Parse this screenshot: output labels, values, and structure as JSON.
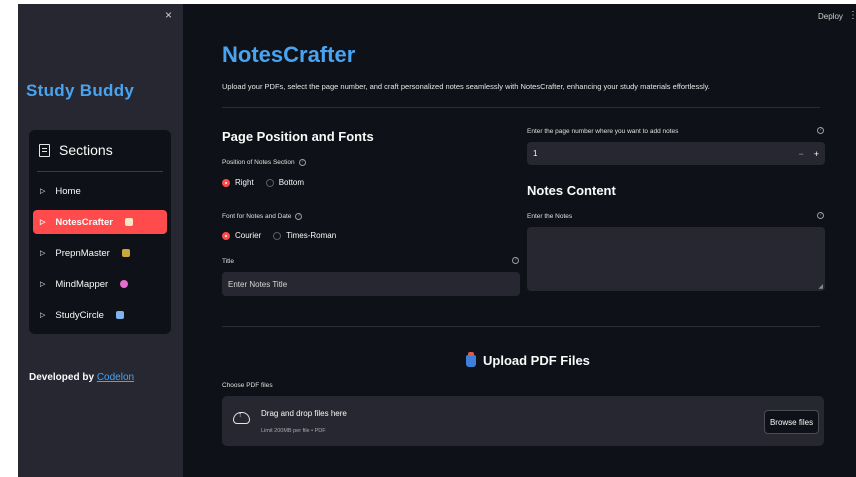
{
  "sidebar": {
    "close_glyph": "×",
    "title": "Study Buddy",
    "sections_label": "Sections",
    "items": [
      {
        "label": "Home",
        "active": false
      },
      {
        "label": "NotesCrafter",
        "active": true
      },
      {
        "label": "PrepnMaster",
        "active": false
      },
      {
        "label": "MindMapper",
        "active": false
      },
      {
        "label": "StudyCircle",
        "active": false
      }
    ],
    "developed_by": "Developed by",
    "developer_link": "Codelon"
  },
  "header": {
    "deploy_label": "Deploy",
    "menu_glyph": "⋮"
  },
  "main": {
    "title": "NotesCrafter",
    "description": "Upload your PDFs, select the page number, and craft personalized notes seamlessly with NotesCrafter, enhancing your study materials effortlessly.",
    "page_position_heading": "Page Position and Fonts",
    "position_label": "Position of Notes Section",
    "position_options": [
      "Right",
      "Bottom"
    ],
    "position_selected": "Right",
    "font_label": "Font for Notes and Date",
    "font_options": [
      "Courier",
      "Times-Roman"
    ],
    "font_selected": "Courier",
    "title_label": "Title",
    "title_placeholder": "Enter Notes Title",
    "page_number_label": "Enter the page number where you want to add notes",
    "page_number_value": "1",
    "minus_glyph": "−",
    "plus_glyph": "+",
    "notes_content_heading": "Notes Content",
    "notes_label": "Enter the Notes",
    "upload_heading": "Upload PDF Files",
    "choose_label": "Choose PDF files",
    "dropzone_text": "Drag and drop files here",
    "dropzone_limit": "Limit 200MB per file • PDF",
    "browse_label": "Browse files"
  },
  "colors": {
    "accent": "#ff4b4b",
    "brand_blue": "#4aa3f0",
    "background": "#0e1117",
    "sidebar_bg": "#262730"
  }
}
